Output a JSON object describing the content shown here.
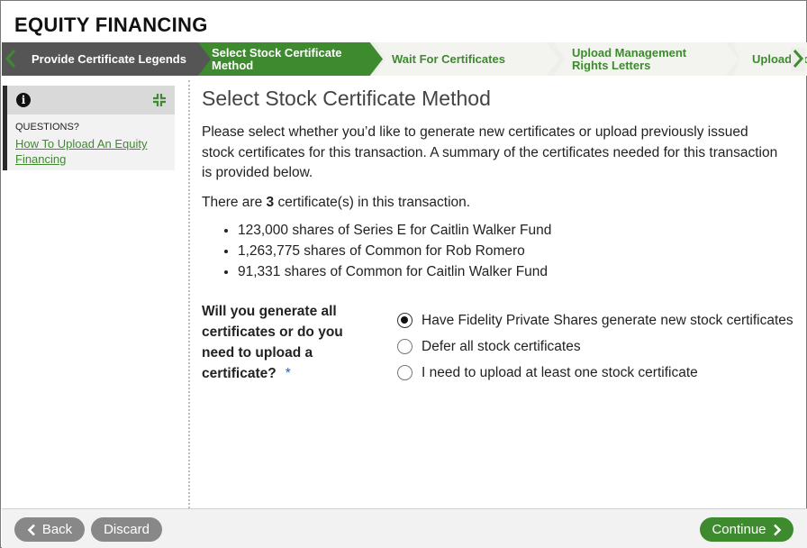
{
  "app": {
    "title": "EQUITY FINANCING"
  },
  "stepper": {
    "steps": [
      {
        "label": "Provide Certificate Legends",
        "state": "completed"
      },
      {
        "label": "Select Stock Certificate Method",
        "state": "active"
      },
      {
        "label": "Wait For Certificates",
        "state": "pending"
      },
      {
        "label": "Upload Management Rights Letters",
        "state": "pending"
      },
      {
        "label": "Upload Documents",
        "state": "pending"
      }
    ],
    "prev_icon": "chevron-left-icon",
    "next_icon": "chevron-right-icon"
  },
  "sidebar": {
    "info_icon": "info-icon",
    "collapse_icon": "collapse-icon",
    "questions_label": "QUESTIONS?",
    "help_link": "How To Upload An Equity Financing"
  },
  "main": {
    "title": "Select Stock Certificate Method",
    "intro": "Please select whether you’d like to generate new certificates or upload previously issued stock certificates for this transaction. A summary of the certificates needed for this transaction is provided below.",
    "count_prefix": "There are ",
    "count_value": "3",
    "count_suffix": " certificate(s) in this transaction.",
    "certificates": [
      "123,000 shares of Series E for Caitlin Walker Fund",
      "1,263,775 shares of Common for Rob Romero",
      "91,331 shares of Common for Caitlin Walker Fund"
    ]
  },
  "question": {
    "label": "Will you generate all certificates or do you need to upload a certificate?",
    "required_mark": "*",
    "options": [
      {
        "label": "Have Fidelity Private Shares generate new stock certificates",
        "selected": true
      },
      {
        "label": "Defer all stock certificates",
        "selected": false
      },
      {
        "label": "I need to upload at least one stock certificate",
        "selected": false
      }
    ]
  },
  "footer": {
    "back_label": "Back",
    "discard_label": "Discard",
    "continue_label": "Continue"
  },
  "colors": {
    "accent_green": "#3d8b2e",
    "completed_gray": "#555555",
    "button_gray": "#888888"
  }
}
